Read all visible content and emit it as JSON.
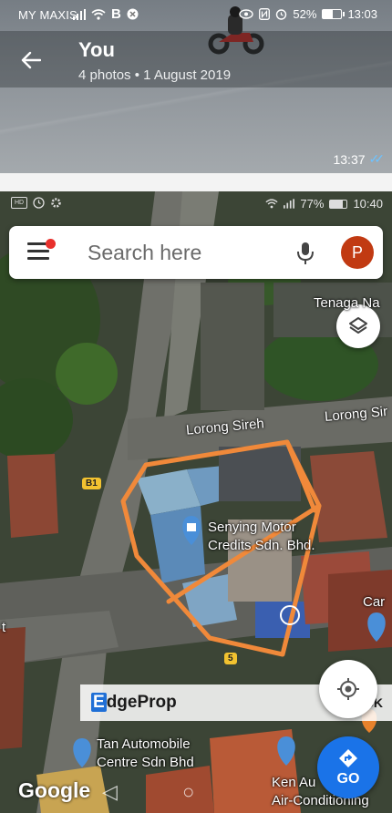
{
  "status_bar": {
    "carrier": "MY MAXIS",
    "battery": "52%",
    "time": "13:03"
  },
  "header": {
    "back_icon": "arrow-left-icon",
    "title": "You",
    "subtitle": "4 photos  •  1 August 2019"
  },
  "message": {
    "time": "13:37",
    "ticks": "✓✓"
  },
  "map_status_bar": {
    "battery": "77%",
    "time": "10:40"
  },
  "search": {
    "placeholder": "Search here",
    "avatar_letter": "P"
  },
  "map_labels": {
    "top_right_place": "Tenaga Na",
    "road_1": "Lorong Sireh",
    "road_2": "Lorong Sir",
    "poi_name_line1": "Senying Motor",
    "poi_name_line2": "Credits Sdn. Bhd.",
    "right_edge_label": "Car",
    "left_edge_label": "t",
    "shield_b1": "B1",
    "shield_5": "5",
    "poi2_line1": "Tan Automobile",
    "poi2_line2": "Centre Sdn Bhd",
    "poi3_line1": "Ken Au",
    "poi3_line2": "Air-Conditioning"
  },
  "buttons": {
    "go_label": "GO"
  },
  "watermark": {
    "brand_first": "E",
    "brand_rest": "dgeProp",
    "tag": "CK"
  },
  "google_logo": "Google",
  "colors": {
    "outline": "#f0893a",
    "go_blue": "#1a73e8",
    "avatar": "#c13a12",
    "notification_dot": "#e8302c",
    "read_ticks": "#6ec3ff"
  }
}
